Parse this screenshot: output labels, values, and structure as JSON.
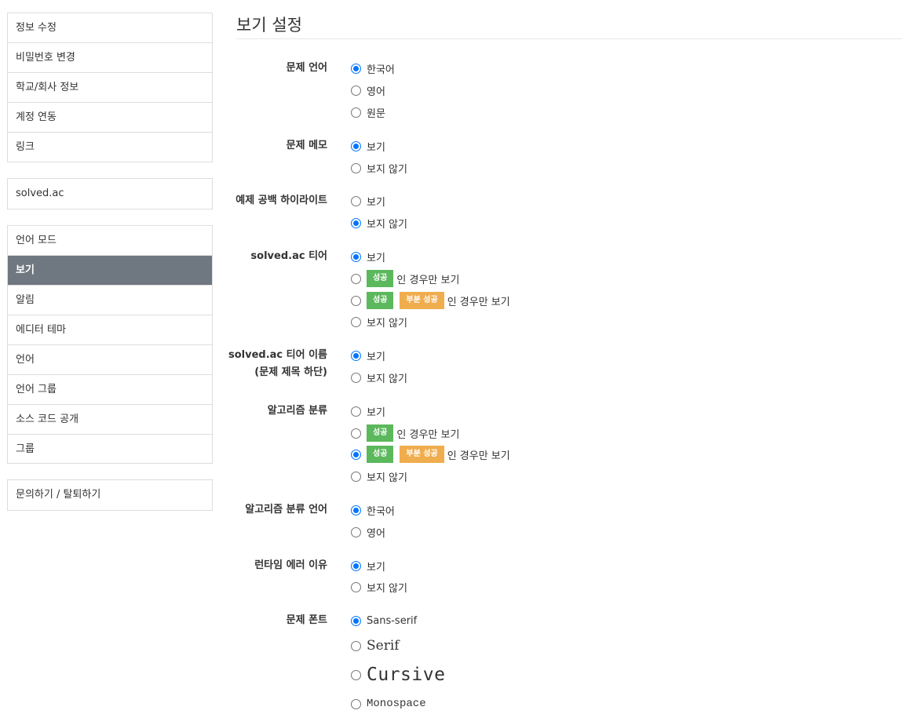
{
  "sidebar": {
    "group1": [
      "정보 수정",
      "비밀번호 변경",
      "학교/회사 정보",
      "계정 연동",
      "링크"
    ],
    "group2": [
      "solved.ac"
    ],
    "group3": [
      "언어 모드",
      "보기",
      "알림",
      "에디터 테마",
      "언어",
      "언어 그룹",
      "소스 코드 공개",
      "그룹"
    ],
    "group4": [
      "문의하기 / 탈퇴하기"
    ],
    "active": "보기"
  },
  "page_title": "보기 설정",
  "badges": {
    "success": "성공",
    "partial": "부분 성공"
  },
  "settings": {
    "problem_language": {
      "label": "문제 언어",
      "options": [
        "한국어",
        "영어",
        "원문"
      ],
      "selected": "한국어"
    },
    "problem_memo": {
      "label": "문제 메모",
      "options": [
        "보기",
        "보지 않기"
      ],
      "selected": "보기"
    },
    "example_whitespace": {
      "label": "예제 공백 하이라이트",
      "options": [
        "보기",
        "보지 않기"
      ],
      "selected": "보지 않기"
    },
    "solvedac_tier": {
      "label": "solved.ac 티어",
      "options": [
        "보기",
        "인 경우만 보기",
        "인 경우만 보기",
        "보지 않기"
      ],
      "selected": "보기"
    },
    "solvedac_tier_name": {
      "label_line1": "solved.ac 티어 이름",
      "label_line2": "(문제 제목 하단)",
      "options": [
        "보기",
        "보지 않기"
      ],
      "selected": "보기"
    },
    "algorithm_tags": {
      "label": "알고리즘 분류",
      "options": [
        "보기",
        "인 경우만 보기",
        "인 경우만 보기",
        "보지 않기"
      ],
      "selected": "성공, 부분 성공 인 경우만 보기"
    },
    "algorithm_tags_language": {
      "label": "알고리즘 분류 언어",
      "options": [
        "한국어",
        "영어"
      ],
      "selected": "한국어"
    },
    "runtime_error_reason": {
      "label": "런타임 에러 이유",
      "options": [
        "보기",
        "보지 않기"
      ],
      "selected": "보기"
    },
    "problem_font": {
      "label": "문제 폰트",
      "options": [
        "Sans-serif",
        "Serif",
        "Cursive",
        "Monospace"
      ],
      "selected": "Sans-serif"
    }
  },
  "colors": {
    "active_nav_bg": "#6f7780",
    "success_badge": "#5cb85c",
    "partial_badge": "#f0ad4e",
    "radio_checked": "#0075ff"
  }
}
